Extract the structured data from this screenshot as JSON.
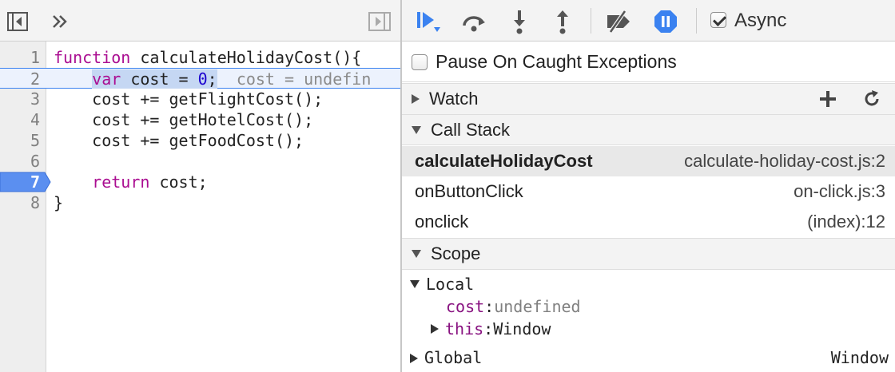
{
  "source": {
    "lines": [
      {
        "num": "1",
        "parts": [
          {
            "t": "function",
            "c": "kw"
          },
          {
            "t": " calculateHolidayCost(){",
            "c": ""
          }
        ]
      },
      {
        "num": "2",
        "parts": [
          {
            "t": "    ",
            "c": ""
          },
          {
            "t": "var",
            "c": "kw sel"
          },
          {
            "t": " cost = ",
            "c": "sel"
          },
          {
            "t": "0",
            "c": "num sel"
          },
          {
            "t": ";",
            "c": "sel"
          },
          {
            "t": "  ",
            "c": ""
          },
          {
            "t": "cost = undefin",
            "c": "inline-val"
          }
        ]
      },
      {
        "num": "3",
        "parts": [
          {
            "t": "    cost += getFlightCost();",
            "c": ""
          }
        ]
      },
      {
        "num": "4",
        "parts": [
          {
            "t": "    cost += getHotelCost();",
            "c": ""
          }
        ]
      },
      {
        "num": "5",
        "parts": [
          {
            "t": "    cost += getFoodCost();",
            "c": ""
          }
        ]
      },
      {
        "num": "6",
        "parts": []
      },
      {
        "num": "7",
        "parts": [
          {
            "t": "    ",
            "c": ""
          },
          {
            "t": "return",
            "c": "kw"
          },
          {
            "t": " cost;",
            "c": ""
          }
        ]
      },
      {
        "num": "8",
        "parts": [
          {
            "t": "}",
            "c": ""
          }
        ]
      }
    ],
    "highlighted_line": "2",
    "breakpoint_line": "7"
  },
  "toolbar": {
    "async_label": "Async",
    "async_checked": true
  },
  "pause_on_caught": {
    "label": "Pause On Caught Exceptions",
    "checked": false
  },
  "watch": {
    "title": "Watch"
  },
  "call_stack": {
    "title": "Call Stack",
    "frames": [
      {
        "name": "calculateHolidayCost",
        "location": "calculate-holiday-cost.js:2",
        "selected": true
      },
      {
        "name": "onButtonClick",
        "location": "on-click.js:3",
        "selected": false
      },
      {
        "name": "onclick",
        "location": "(index):12",
        "selected": false
      }
    ]
  },
  "scope": {
    "title": "Scope",
    "local_label": "Local",
    "local_props": [
      {
        "name": "cost",
        "value": "undefined",
        "expandable": false
      },
      {
        "name": "this",
        "value": "Window",
        "expandable": true
      }
    ],
    "global_label": "Global",
    "global_value": "Window"
  },
  "colors": {
    "accent": "#3b82f0",
    "keyword": "#aa0d91",
    "number": "#1c00cf"
  }
}
